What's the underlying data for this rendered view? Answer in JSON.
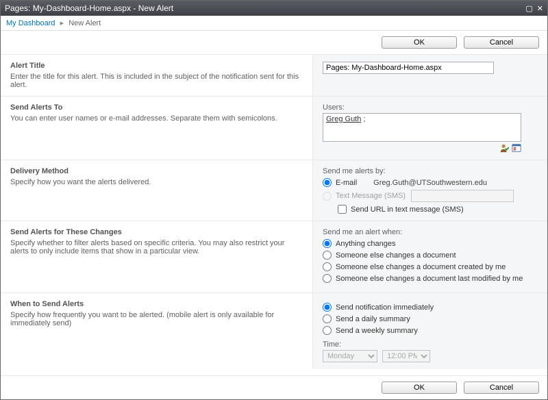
{
  "titlebar": {
    "title": "Pages: My-Dashboard-Home.aspx - New Alert"
  },
  "breadcrumb": {
    "root": "My Dashboard",
    "current": "New Alert"
  },
  "buttons": {
    "ok": "OK",
    "cancel": "Cancel"
  },
  "sections": {
    "alertTitle": {
      "heading": "Alert Title",
      "desc": "Enter the title for this alert. This is included in the subject of the notification sent for this alert.",
      "value": "Pages: My-Dashboard-Home.aspx"
    },
    "sendTo": {
      "heading": "Send Alerts To",
      "desc": "You can enter user names or e-mail addresses. Separate them with semicolons.",
      "label": "Users:",
      "user": "Greg Guth",
      "suffix": " ;"
    },
    "delivery": {
      "heading": "Delivery Method",
      "desc": "Specify how you want the alerts delivered.",
      "label": "Send me alerts by:",
      "email_opt": "E-mail",
      "email_value": "Greg.Guth@UTSouthwestern.edu",
      "sms_opt": "Text Message (SMS)",
      "sms_check": "Send URL in text message (SMS)"
    },
    "changes": {
      "heading": "Send Alerts for These Changes",
      "desc": "Specify whether to filter alerts based on specific criteria. You may also restrict your alerts to only include items that show in a particular view.",
      "label": "Send me an alert when:",
      "opt1": "Anything changes",
      "opt2": "Someone else changes a document",
      "opt3": "Someone else changes a document created by me",
      "opt4": "Someone else changes a document last modified by me"
    },
    "when": {
      "heading": "When to Send Alerts",
      "desc": "Specify how frequently you want to be alerted. (mobile alert is only available for immediately send)",
      "opt1": "Send notification immediately",
      "opt2": "Send a daily summary",
      "opt3": "Send a weekly summary",
      "time_label": "Time:",
      "day": "Monday",
      "time": "12:00 PM"
    }
  }
}
